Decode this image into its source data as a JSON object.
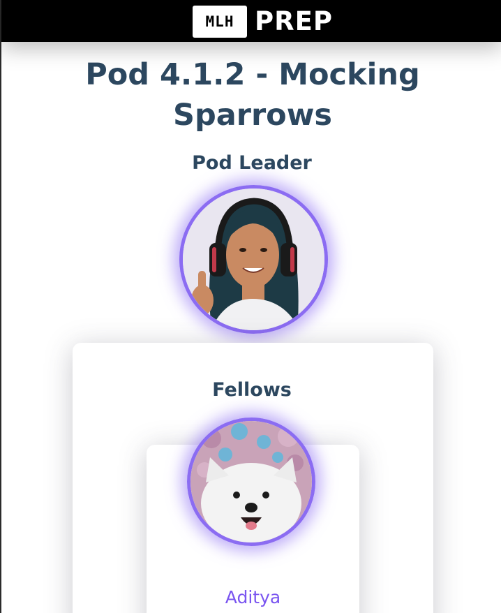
{
  "header": {
    "logo_mark": "MLH",
    "logo_text": "PREP"
  },
  "page": {
    "title": "Pod 4.1.2 - Mocking Sparrows"
  },
  "leader_section": {
    "label": "Pod Leader"
  },
  "fellows_section": {
    "label": "Fellows",
    "fellows": [
      {
        "name": "Aditya"
      }
    ]
  },
  "colors": {
    "title_text": "#2c475f",
    "accent_purple": "#8b6cf2",
    "fellow_name": "#7a55f0",
    "topbar": "#000000"
  }
}
